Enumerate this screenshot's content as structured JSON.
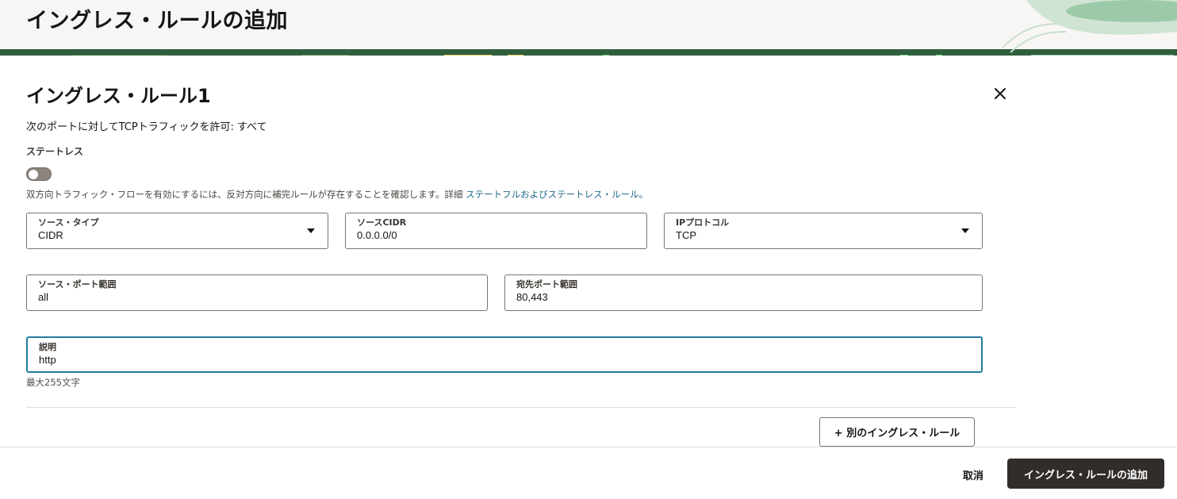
{
  "header": {
    "title": "イングレス・ルールの追加"
  },
  "rule": {
    "title": "イングレス・ルール1",
    "summary": "次のポートに対してTCPトラフィックを許可: すべて",
    "stateless_label": "ステートレス",
    "stateless_enabled": false,
    "help_text": "双方向トラフィック・フローを有効にするには、反対方向に補完ルールが存在することを確認します。詳細 ",
    "help_link": "ステートフルおよびステートレス・ルール。"
  },
  "fields": {
    "source_type": {
      "label": "ソース・タイプ",
      "value": "CIDR"
    },
    "source_cidr": {
      "label": "ソースCIDR",
      "value": "0.0.0.0/0"
    },
    "ip_protocol": {
      "label": "IPプロトコル",
      "value": "TCP"
    },
    "source_port": {
      "label": "ソース・ポート範囲",
      "value": "all"
    },
    "dest_port": {
      "label": "宛先ポート範囲",
      "value": "80,443"
    },
    "description": {
      "label": "説明",
      "value": "http",
      "hint": "最大255文字"
    }
  },
  "buttons": {
    "add_another": "+ 別のイングレス・ルール",
    "cancel": "取消",
    "submit": "イングレス・ルールの追加"
  },
  "colors": {
    "primary_button": "#312d2a",
    "link": "#1d6a86",
    "focus": "#227e9e"
  }
}
